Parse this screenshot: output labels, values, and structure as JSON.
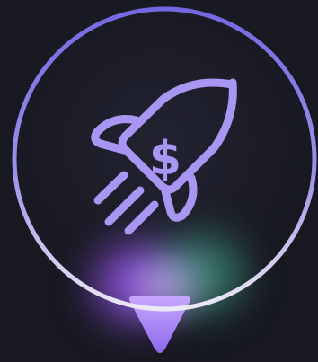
{
  "badge": {
    "icon": "rocket-dollar-icon",
    "currency_symbol": "$"
  },
  "colors": {
    "background": "#171820",
    "ring_top": "#7a6fe6",
    "ring_bottom": "#e4e0f2",
    "icon": "#a896f2",
    "pointer": "#a07cf0",
    "glow_violet": "#a05aff",
    "glow_teal": "#50c8aa"
  }
}
